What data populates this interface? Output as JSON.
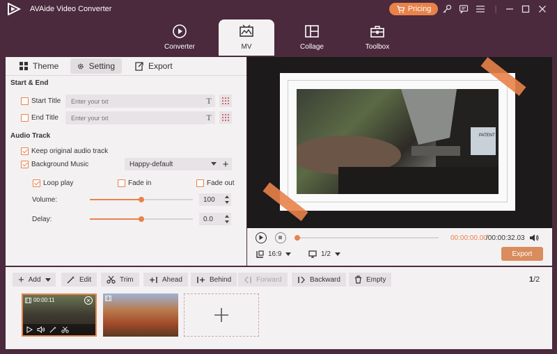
{
  "app": {
    "title": "AVAide Video Converter",
    "pricing_label": "Pricing",
    "accent": "#e8824a",
    "background": "#4a2a3c"
  },
  "nav": {
    "tabs": [
      {
        "label": "Converter",
        "icon": "converter-icon",
        "active": false
      },
      {
        "label": "MV",
        "icon": "mv-icon",
        "active": true
      },
      {
        "label": "Collage",
        "icon": "collage-icon",
        "active": false
      },
      {
        "label": "Toolbox",
        "icon": "toolbox-icon",
        "active": false
      }
    ]
  },
  "subtabs": {
    "theme": "Theme",
    "setting": "Setting",
    "export": "Export"
  },
  "start_end": {
    "title": "Start & End",
    "start_title_label": "Start Title",
    "end_title_label": "End Title",
    "placeholder": "Enter your txt"
  },
  "audio": {
    "title": "Audio Track",
    "keep_original": "Keep original audio track",
    "background_music": "Background Music",
    "music_selected": "Happy-default",
    "loop_play": "Loop play",
    "fade_in": "Fade in",
    "fade_out": "Fade out",
    "volume_label": "Volume:",
    "volume_value": "100",
    "volume_fraction": 0.5,
    "delay_label": "Delay:",
    "delay_value": "0.0",
    "delay_fraction": 0.5
  },
  "player": {
    "time_current": "00:00:00.00",
    "time_total": "/00:00:32.03",
    "ratio": "16:9",
    "pages": "1/2",
    "export_label": "Export"
  },
  "toolbar": {
    "add": "Add",
    "edit": "Edit",
    "trim": "Trim",
    "ahead": "Ahead",
    "behind": "Behind",
    "forward": "Forward",
    "backward": "Backward",
    "empty": "Empty",
    "page_current": "1",
    "page_total": "/2"
  },
  "clips": [
    {
      "time": "00:00:11"
    }
  ]
}
